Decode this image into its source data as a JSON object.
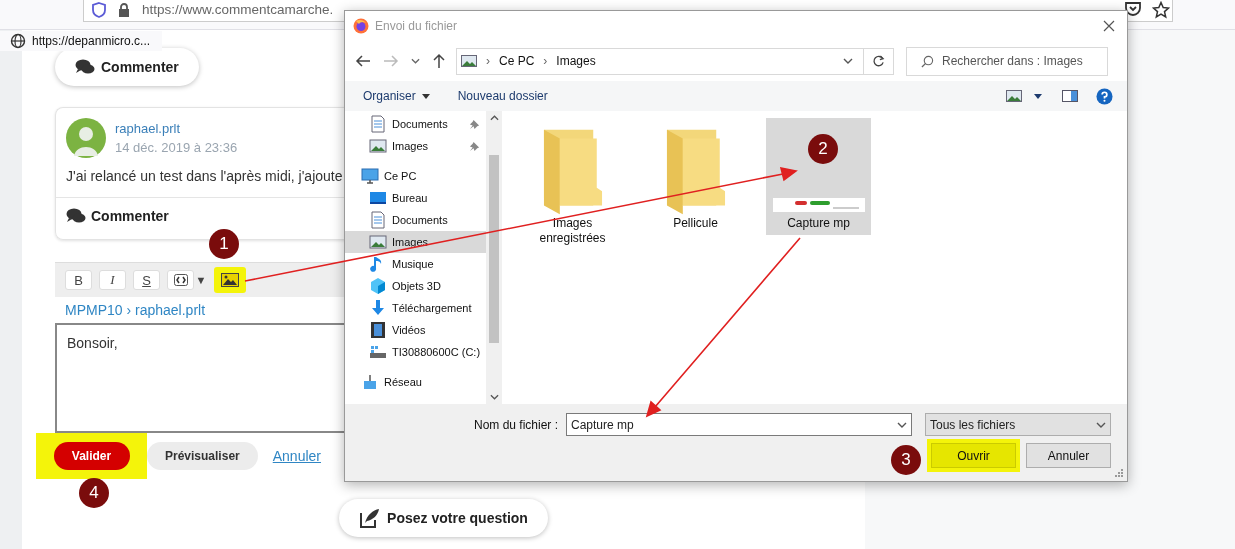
{
  "browser": {
    "url": "https://www.commentcamarche.",
    "link_preview": "https://depanmicro.c..."
  },
  "forum": {
    "comment_button": "Commenter",
    "post": {
      "author": "raphael.prlt",
      "date": "14 déc. 2019 à 23:36",
      "text": "J'ai relancé un test dans l'après midi, j'ajoute",
      "comment_button": "Commenter"
    },
    "editor": {
      "tools": [
        {
          "kind": "bold",
          "label": "B",
          "highlighted": false
        },
        {
          "kind": "italic",
          "label": "I",
          "highlighted": false
        },
        {
          "kind": "strike",
          "label": "S",
          "highlighted": false
        },
        {
          "kind": "code",
          "highlighted": false
        },
        {
          "kind": "dropdown",
          "label": "▼",
          "highlighted": false
        },
        {
          "kind": "image",
          "highlighted": true
        }
      ],
      "breadcrumb": "MPMP10 › raphael.prlt",
      "value": "Bonsoir,",
      "submit": {
        "label": "Valider",
        "highlighted": true
      },
      "preview": "Prévisualiser",
      "cancel": "Annuler"
    },
    "ask_button": "Posez votre question"
  },
  "dialog": {
    "title": "Envoi du fichier",
    "path": [
      "Ce PC",
      "Images"
    ],
    "path_separator": "›",
    "search_placeholder": "Rechercher dans : Images",
    "toolbar": {
      "organize": "Organiser",
      "new_folder": "Nouveau dossier"
    },
    "sidebar": [
      {
        "label": "Documents",
        "kind": "documents",
        "pinned": true,
        "selected": false
      },
      {
        "label": "Images",
        "kind": "images",
        "pinned": true,
        "selected": false
      },
      {
        "label": "Ce PC",
        "kind": "pc",
        "selected": false,
        "children": [
          {
            "label": "Bureau",
            "kind": "desktop",
            "selected": false
          },
          {
            "label": "Documents",
            "kind": "documents",
            "selected": false
          },
          {
            "label": "Images",
            "kind": "images",
            "selected": true
          },
          {
            "label": "Musique",
            "kind": "music",
            "selected": false
          },
          {
            "label": "Objets 3D",
            "kind": "objects3d",
            "selected": false
          },
          {
            "label": "Téléchargement",
            "kind": "downloads",
            "selected": false
          },
          {
            "label": "Vidéos",
            "kind": "videos",
            "selected": false
          },
          {
            "label": "TI30880600C (C:)",
            "kind": "drive",
            "selected": false
          }
        ]
      },
      {
        "label": "Réseau",
        "kind": "network",
        "selected": false
      }
    ],
    "files": [
      {
        "name": "Images enregistrées",
        "kind": "folder",
        "selected": false
      },
      {
        "name": "Pellicule",
        "kind": "folder",
        "selected": false
      },
      {
        "name": "Capture mp",
        "kind": "image",
        "selected": true
      }
    ],
    "filename_label": "Nom du fichier :",
    "filename": "Capture mp",
    "filter": "Tous les fichiers",
    "open": {
      "label": "Ouvrir",
      "highlighted": true
    },
    "cancel": "Annuler"
  },
  "annotations": [
    {
      "label": "1"
    },
    {
      "label": "2"
    },
    {
      "label": "3"
    },
    {
      "label": "4"
    }
  ]
}
